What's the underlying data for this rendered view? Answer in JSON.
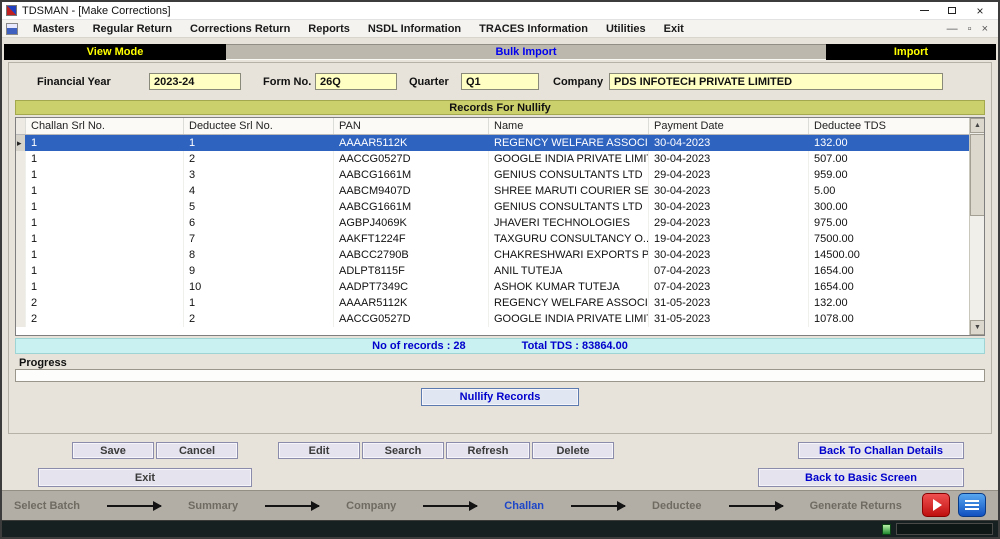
{
  "window": {
    "title": "TDSMAN - [Make Corrections]"
  },
  "menu": {
    "items": [
      "Masters",
      "Regular Return",
      "Corrections Return",
      "Reports",
      "NSDL Information",
      "TRACES Information",
      "Utilities",
      "Exit"
    ]
  },
  "mode_bar": {
    "left": "View Mode",
    "center": "Bulk Import",
    "right": "Import"
  },
  "form": {
    "financial_year": {
      "label": "Financial Year",
      "value": "2023-24"
    },
    "form_no": {
      "label": "Form No.",
      "value": "26Q"
    },
    "quarter": {
      "label": "Quarter",
      "value": "Q1"
    },
    "company": {
      "label": "Company",
      "value": "PDS INFOTECH PRIVATE LIMITED"
    }
  },
  "records": {
    "title": "Records For Nullify",
    "columns": [
      "Challan Srl No.",
      "Deductee Srl No.",
      "PAN",
      "Name",
      "Payment Date",
      "Deductee TDS"
    ],
    "selected_row_index": 0,
    "rows": [
      [
        "1",
        "1",
        "AAAAR5112K",
        "REGENCY WELFARE ASSOCIA...",
        "30-04-2023",
        "132.00"
      ],
      [
        "1",
        "2",
        "AACCG0527D",
        "GOOGLE INDIA PRIVATE LIMIT...",
        "30-04-2023",
        "507.00"
      ],
      [
        "1",
        "3",
        "AABCG1661M",
        "GENIUS CONSULTANTS LTD",
        "29-04-2023",
        "959.00"
      ],
      [
        "1",
        "4",
        "AABCM9407D",
        "SHREE MARUTI COURIER SE...",
        "30-04-2023",
        "5.00"
      ],
      [
        "1",
        "5",
        "AABCG1661M",
        "GENIUS CONSULTANTS LTD",
        "30-04-2023",
        "300.00"
      ],
      [
        "1",
        "6",
        "AGBPJ4069K",
        "JHAVERI TECHNOLOGIES",
        "29-04-2023",
        "975.00"
      ],
      [
        "1",
        "7",
        "AAKFT1224F",
        "TAXGURU CONSULTANCY  O...",
        "19-04-2023",
        "7500.00"
      ],
      [
        "1",
        "8",
        "AABCC2790B",
        "CHAKRESHWARI EXPORTS P...",
        "30-04-2023",
        "14500.00"
      ],
      [
        "1",
        "9",
        "ADLPT8115F",
        "ANIL TUTEJA",
        "07-04-2023",
        "1654.00"
      ],
      [
        "1",
        "10",
        "AADPT7349C",
        "ASHOK KUMAR TUTEJA",
        "07-04-2023",
        "1654.00"
      ],
      [
        "2",
        "1",
        "AAAAR5112K",
        "REGENCY WELFARE ASSOCIA...",
        "31-05-2023",
        "132.00"
      ],
      [
        "2",
        "2",
        "AACCG0527D",
        "GOOGLE INDIA PRIVATE LIMIT...",
        "31-05-2023",
        "1078.00"
      ]
    ],
    "summary": {
      "no_of_records": "No of records : 28",
      "total_tds": "Total TDS : 83864.00"
    }
  },
  "progress": {
    "label": "Progress",
    "percent": 0
  },
  "buttons": {
    "nullify": "Nullify Records",
    "save": "Save",
    "cancel": "Cancel",
    "edit": "Edit",
    "search": "Search",
    "refresh": "Refresh",
    "delete": "Delete",
    "back_to_challan": "Back To Challan Details",
    "exit": "Exit",
    "back_to_basic": "Back to Basic Screen"
  },
  "workflow": {
    "steps": [
      "Select Batch",
      "Summary",
      "Company",
      "Challan",
      "Deductee",
      "Generate Returns"
    ],
    "active_index": 3
  },
  "colors": {
    "accent_blue": "#0000cc",
    "highlight": "#2f63c0",
    "mode_bar_bg": "#000000",
    "mode_bar_text": "#ffff00"
  }
}
